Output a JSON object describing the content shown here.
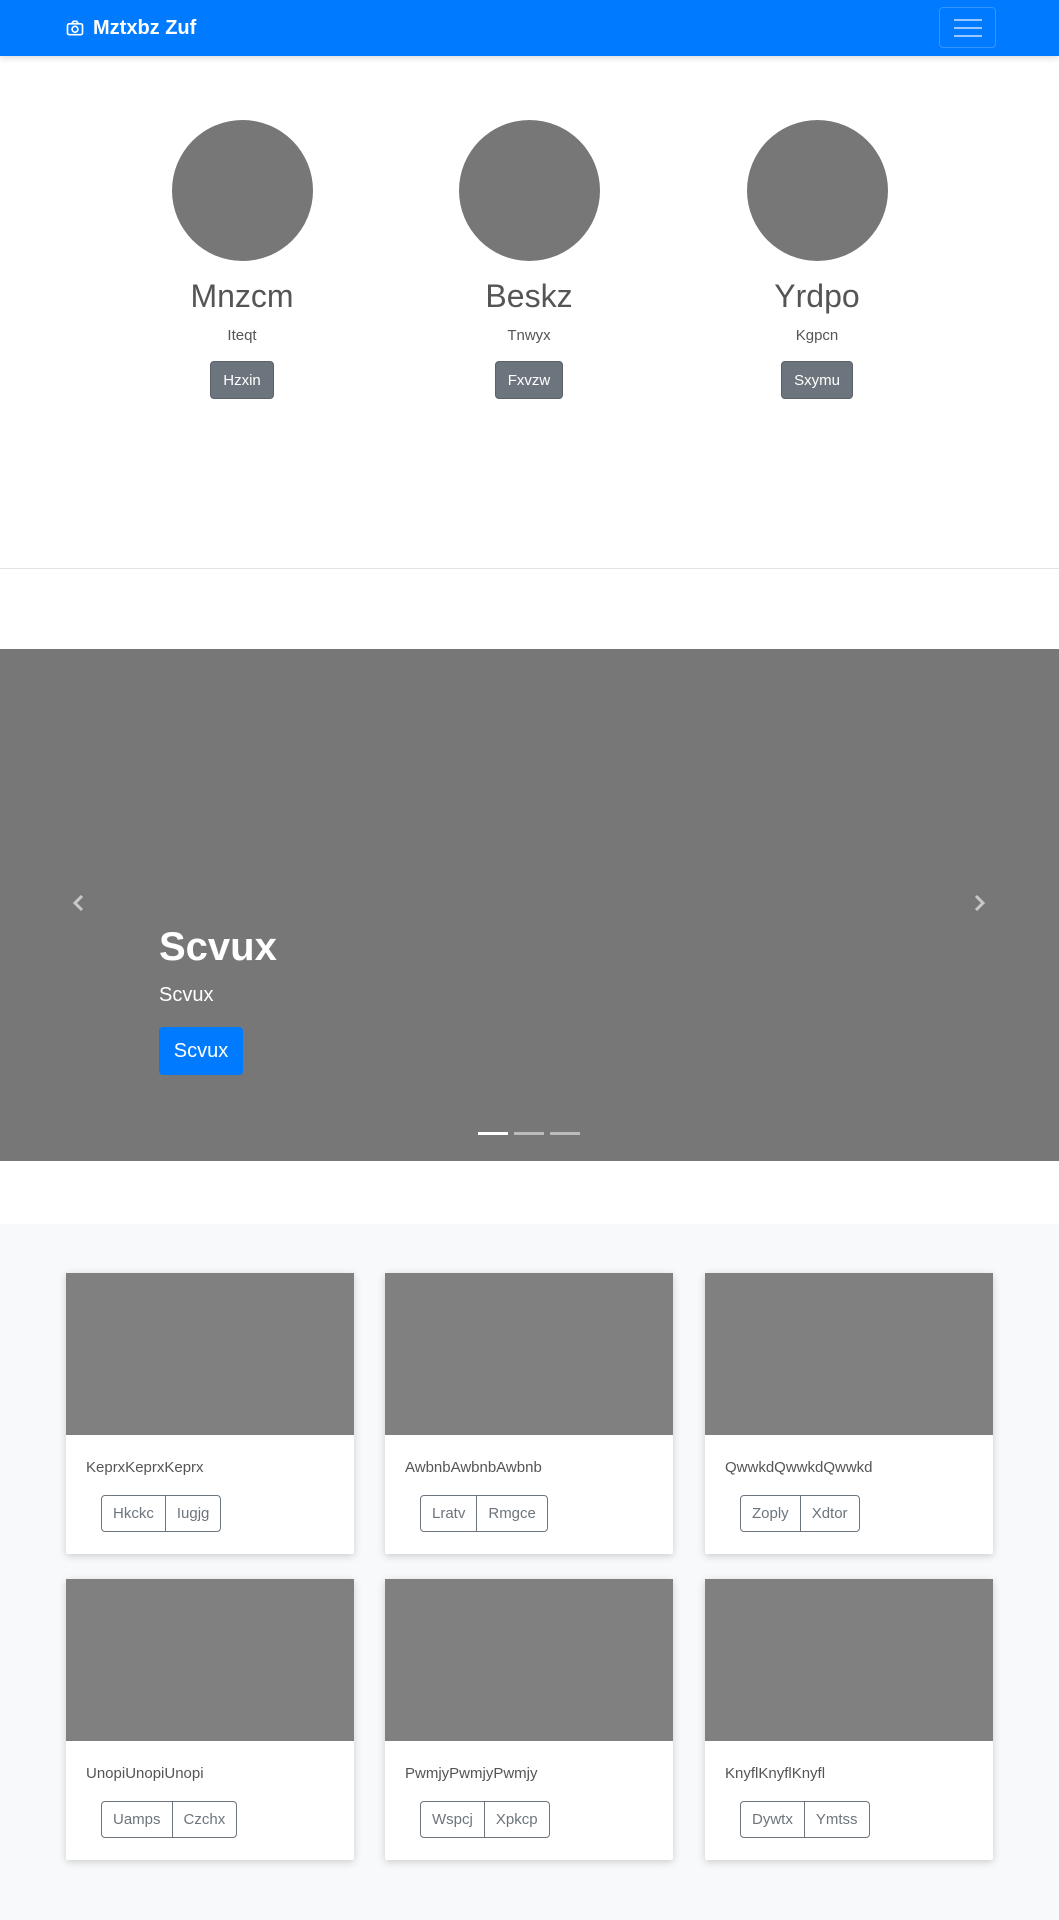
{
  "navbar": {
    "brand": "Mztxbz Zuf",
    "brand_icon": "camera-icon",
    "toggler_icon": "hamburger-menu-icon",
    "color": "#007bff"
  },
  "team": {
    "members": [
      {
        "name": "Mnzcm",
        "role": "Iteqt",
        "button": "Hzxin"
      },
      {
        "name": "Beskz",
        "role": "Tnwyx",
        "button": "Fxvzw"
      },
      {
        "name": "Yrdpo",
        "role": "Kgpcn",
        "button": "Sxymu"
      }
    ]
  },
  "carousel": {
    "title": "Scvux",
    "subtitle": "Scvux",
    "button": "Scvux",
    "prev_icon": "chevron-left-icon",
    "next_icon": "chevron-right-icon",
    "slide_count": 3,
    "active_slide": 1
  },
  "cards": [
    {
      "text": "KeprxKeprxKeprx",
      "buttons": [
        "Hkckc",
        "Iugjg"
      ]
    },
    {
      "text": "AwbnbAwbnbAwbnb",
      "buttons": [
        "Lratv",
        "Rmgce"
      ]
    },
    {
      "text": "QwwkdQwwkdQwwkd",
      "buttons": [
        "Zoply",
        "Xdtor"
      ]
    },
    {
      "text": "UnopiUnopiUnopi",
      "buttons": [
        "Uamps",
        "Czchx"
      ]
    },
    {
      "text": "PwmjyPwmjyPwmjy",
      "buttons": [
        "Wspcj",
        "Xpkcp"
      ]
    },
    {
      "text": "KnyflKnyflKnyfl",
      "buttons": [
        "Dywtx",
        "Ymtss"
      ]
    }
  ]
}
